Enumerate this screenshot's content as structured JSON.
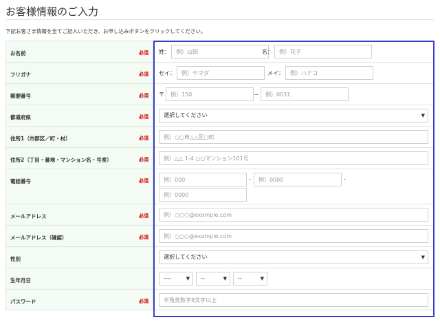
{
  "page": {
    "title": "お客様情報のご入力",
    "intro": "下記お客さま情報を全てご記入いただき、お申し込みボタンをクリックしてください。",
    "required_badge": "必須"
  },
  "rows": {
    "name": {
      "label": "お名前",
      "sei_label": "姓：",
      "sei_placeholder": "例）山田",
      "mei_label": "名：",
      "mei_placeholder": "例）花子"
    },
    "kana": {
      "label": "フリガナ",
      "sei_label": "セイ：",
      "sei_placeholder": "例）ヤマダ",
      "mei_label": "メイ：",
      "mei_placeholder": "例）ハナコ"
    },
    "postal": {
      "label": "郵便番号",
      "prefix": "〒",
      "first_placeholder": "例）150",
      "dash": "－",
      "second_placeholder": "例）0031"
    },
    "prefecture": {
      "label": "都道府県",
      "selected": "選択してください"
    },
    "address1": {
      "label": "住所1（市郡区／町・村）",
      "placeholder": "例）○○市△△区□町"
    },
    "address2": {
      "label": "住所2（丁目・番地・マンション名・号室）",
      "placeholder": "例）△△ 1-4 ○○マンション101号"
    },
    "phone": {
      "label": "電話番号",
      "first_placeholder": "例）000",
      "dash": "-",
      "second_placeholder": "例）0000",
      "third_placeholder": "例）0000"
    },
    "email": {
      "label": "メールアドレス",
      "placeholder": "例）○○○@example.com"
    },
    "email_confirm": {
      "label": "メールアドレス（確認）",
      "placeholder": "例）○○○@example.com"
    },
    "gender": {
      "label": "性別",
      "selected": "選択してください"
    },
    "birthday": {
      "label": "生年月日",
      "year": "----",
      "month": "--",
      "day": "--"
    },
    "password": {
      "label": "パスワード",
      "placeholder": "半角英数字8文字以上"
    }
  },
  "icons": {
    "select_arrow": "chevron-down-icon"
  },
  "colors": {
    "label_bg": "#f4fbf4",
    "required": "#cc0000",
    "highlight_frame": "#3a3acb"
  }
}
